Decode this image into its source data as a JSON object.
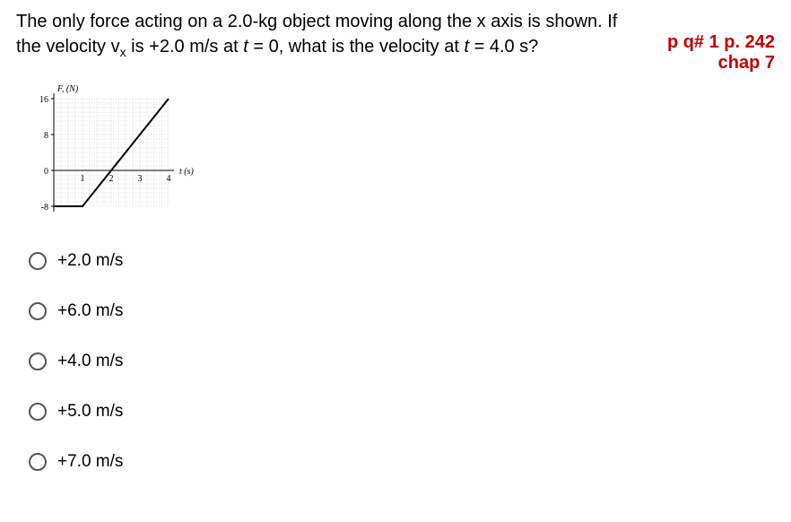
{
  "question": {
    "html": "The only force acting on a 2.0-kg object moving along the x axis is shown. If the velocity v<sub>x</sub> is +2.0 m/s at <span class='italic'>t</span> = 0, what is the velocity at <span class='italic'>t</span> = 4.0 s?"
  },
  "reference": {
    "line1": "p q# 1 p. 242",
    "line2": "chap 7"
  },
  "chart_data": {
    "type": "line",
    "title": "",
    "xlabel": "t (s)",
    "ylabel": "F, (N)",
    "xlim": [
      0,
      4
    ],
    "ylim": [
      -8,
      16
    ],
    "x": [
      0,
      1,
      4
    ],
    "y": [
      -8,
      -8,
      16
    ],
    "x_ticks": [
      1,
      2,
      3,
      4
    ],
    "y_ticks": [
      -8,
      0,
      8,
      16
    ]
  },
  "options": [
    {
      "label": "+2.0 m/s"
    },
    {
      "label": "+6.0 m/s"
    },
    {
      "label": "+4.0 m/s"
    },
    {
      "label": "+5.0 m/s"
    },
    {
      "label": "+7.0 m/s"
    }
  ]
}
